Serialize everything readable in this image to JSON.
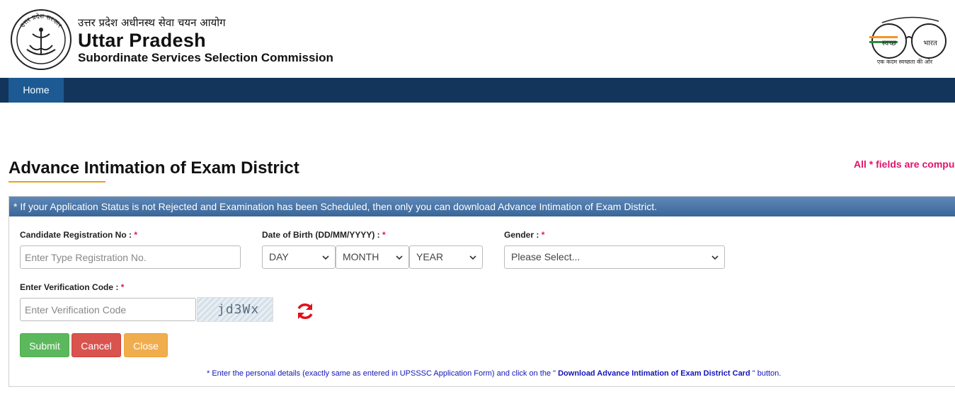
{
  "header": {
    "hindi_name": "उत्तर प्रदेश अधीनस्थ सेवा चयन आयोग",
    "org_name": "Uttar Pradesh",
    "org_sub": "Subordinate Services Selection Commission",
    "emblem_text": "उत्तर प्रदेश सरकार",
    "swachh_left": "स्वच्छ",
    "swachh_right": "भारत",
    "swachh_tagline": "एक कदम स्वच्छता की ओर"
  },
  "nav": {
    "home": "Home"
  },
  "page": {
    "title": "Advance Intimation of Exam District",
    "required_note": "All * fields are compu"
  },
  "panel": {
    "notice": "* If your Application Status is not Rejected and Examination has been Scheduled, then only you can download Advance Intimation of Exam District."
  },
  "form": {
    "reg_label": "Candidate Registration No : ",
    "reg_placeholder": "Enter Type Registration No.",
    "dob_label": "Date of Birth (DD/MM/YYYY) : ",
    "day_value": "DAY",
    "month_value": "MONTH",
    "year_value": "YEAR",
    "gender_label": "Gender : ",
    "gender_value": "Please Select...",
    "captcha_label": "Enter Verification Code : ",
    "captcha_placeholder": "Enter Verification Code",
    "captcha_text": "jd3Wx",
    "star": "*"
  },
  "buttons": {
    "submit": "Submit",
    "cancel": "Cancel",
    "close": "Close"
  },
  "footer": {
    "note_prefix": "* Enter the personal details (exactly same as entered in UPSSSC Application Form) and click on the \"",
    "note_bold": " Download Advance Intimation of Exam District Card ",
    "note_suffix": "\" button."
  },
  "colors": {
    "nav": "#13355c",
    "nav_active": "#1d5a93",
    "accent_pink": "#e0136b",
    "submit": "#5cb85c",
    "cancel": "#d9534f",
    "close": "#f0ad4e"
  }
}
